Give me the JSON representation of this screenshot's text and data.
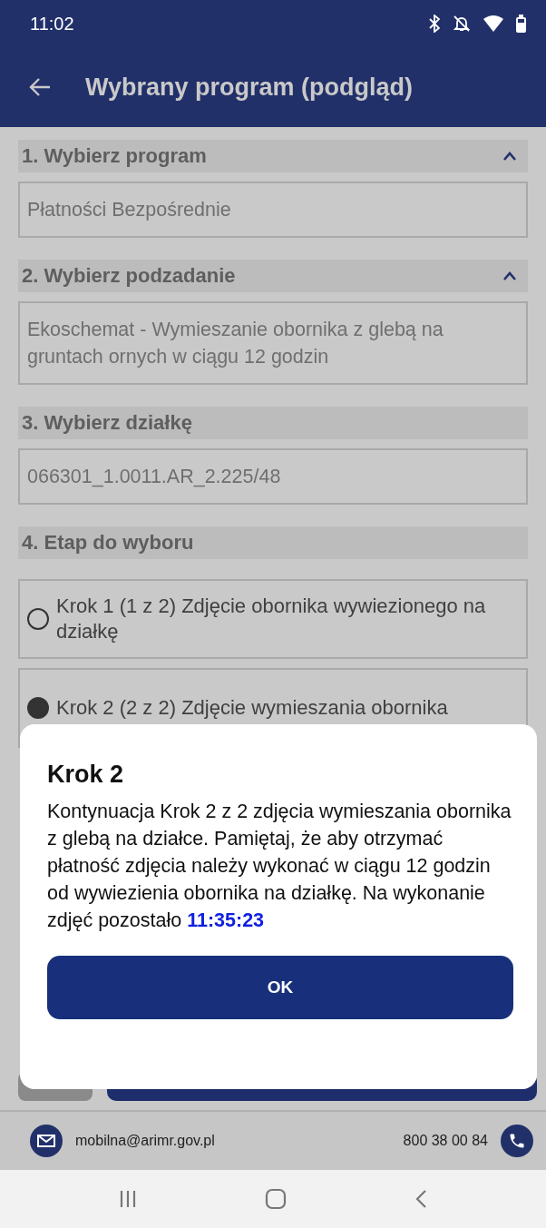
{
  "status_bar": {
    "time": "11:02"
  },
  "app_bar": {
    "title": "Wybrany program (podgląd)"
  },
  "sections": [
    {
      "kind": "field",
      "title": "1. Wybierz program",
      "expanded": true,
      "value": "Płatności Bezpośrednie"
    },
    {
      "kind": "field",
      "title": "2. Wybierz podzadanie",
      "expanded": true,
      "value": "Ekoschemat - Wymieszanie obornika z glebą na gruntach ornych w ciągu 12 godzin"
    },
    {
      "kind": "field",
      "title": "3. Wybierz działkę",
      "value": "066301_1.0011.AR_2.225/48"
    },
    {
      "kind": "options",
      "title": "4. Etap do wyboru",
      "options": [
        {
          "label": "Krok 1 (1 z 2) Zdjęcie obornika wywiezionego na działkę",
          "selected": false
        },
        {
          "label": "Krok 2 (2 z 2) Zdjęcie wymieszania obornika",
          "selected": true
        }
      ]
    }
  ],
  "footer": {
    "email": "mobilna@arimr.gov.pl",
    "phone": "800 38 00 84"
  },
  "dialog": {
    "title": "Krok 2",
    "message": "Kontynuacja Krok 2 z 2 zdjęcia wymieszania obornika z glebą na działce. Pamiętaj, że aby otrzymać płatność zdjęcia należy wykonać w ciągu 12 godzin od wywiezienia obornika na działkę. Na wykonanie zdjęć pozostało **11:35:23**",
    "button": "OK"
  }
}
